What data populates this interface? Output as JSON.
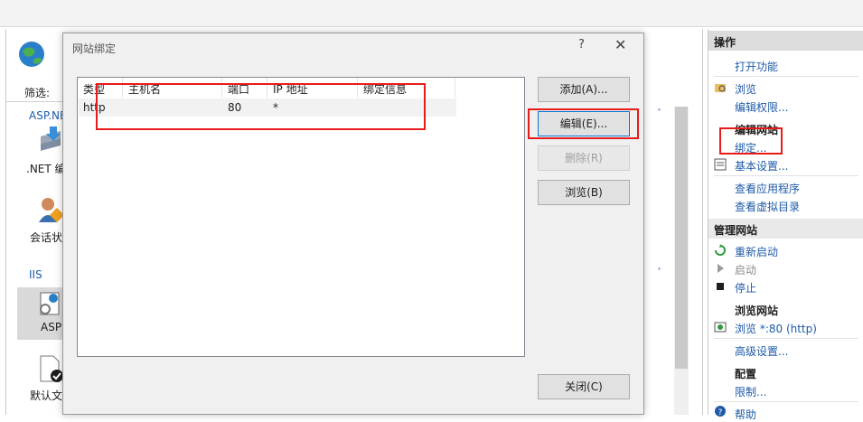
{
  "left_panel": {
    "filter_label": "筛选:",
    "group_aspnet": "ASP.NE",
    "item_net": ".NET 编",
    "item_session": "会话状",
    "group_iis": "IIS",
    "item_asp": "ASP",
    "item_default_doc": "默认文"
  },
  "dialog": {
    "title": "网站绑定",
    "help": "?",
    "close": "✕",
    "columns": [
      "类型",
      "主机名",
      "端口",
      "IP 地址",
      "绑定信息"
    ],
    "rows": [
      {
        "type": "http",
        "host": "",
        "port": "80",
        "ip": "*",
        "info": ""
      }
    ],
    "buttons": {
      "add": "添加(A)...",
      "edit": "编辑(E)...",
      "remove": "删除(R)",
      "browse": "浏览(B)",
      "close": "关闭(C)"
    }
  },
  "actions": {
    "header": "操作",
    "open_feature": "打开功能",
    "explore": "浏览",
    "edit_permissions": "编辑权限...",
    "edit_site_heading": "编辑网站",
    "bindings": "绑定...",
    "basic_settings": "基本设置...",
    "view_apps": "查看应用程序",
    "view_vdirs": "查看虚拟目录",
    "manage_site_header": "管理网站",
    "restart": "重新启动",
    "start": "启动",
    "stop": "停止",
    "browse_site_heading": "浏览网站",
    "browse_80": "浏览 *:80 (http)",
    "advanced_settings": "高级设置...",
    "config_heading": "配置",
    "limits": "限制...",
    "help": "帮助"
  },
  "colors": {
    "annotation_red": "#e81b1b",
    "link_blue": "#1e5aa8"
  }
}
